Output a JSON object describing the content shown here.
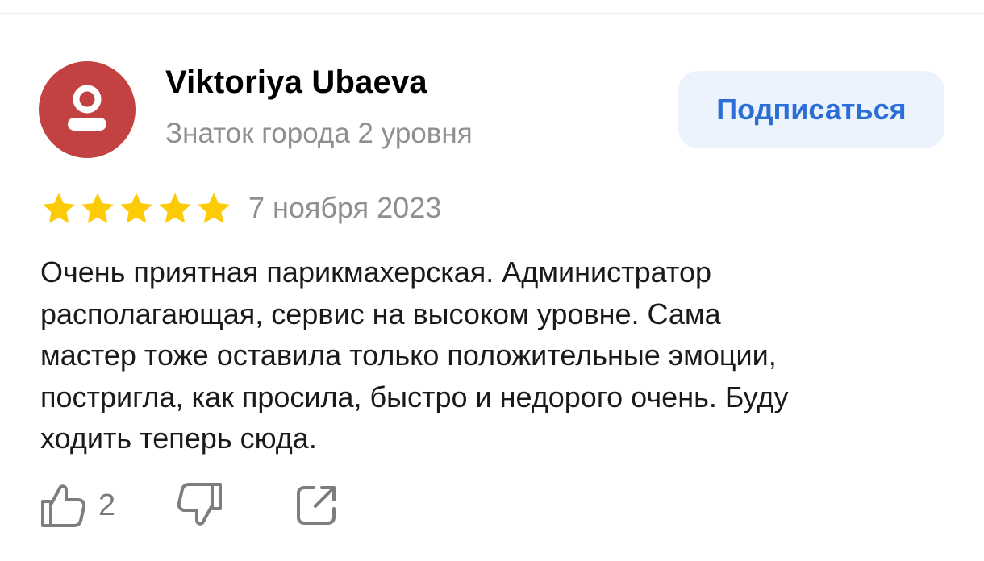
{
  "author": {
    "name": "Viktoriya Ubaeva",
    "level": "Знаток города 2 уровня",
    "avatar_icon": "user-icon",
    "avatar_color": "#c24242"
  },
  "subscribe": {
    "label": "Подписаться",
    "background": "#edf3fd",
    "text_color": "#2b6ed6"
  },
  "review": {
    "rating": 5,
    "rating_max": 5,
    "star_color": "#fccb05",
    "date": "7 ноября 2023",
    "text_lines": [
      "Очень приятная парикмахерская. Администратор",
      "располагающая, сервис на высоком уровне. Сама",
      "мастер тоже оставила только положительные эмоции,",
      "постригла, как просила, быстро и недорого очень. Буду",
      "ходить теперь сюда."
    ]
  },
  "actions": {
    "like_icon": "thumbs-up-icon",
    "like_count": "2",
    "dislike_icon": "thumbs-down-icon",
    "share_icon": "share-icon"
  }
}
